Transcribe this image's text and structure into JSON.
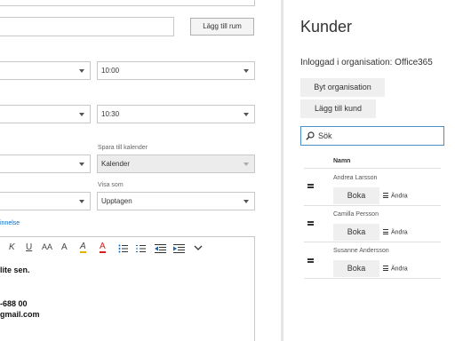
{
  "left_panel": {
    "add_room_button": "Lägg till rum",
    "start_time": "10:00",
    "end_time": "10:30",
    "save_to_calendar_label": "Spara till kalender",
    "calendar_value": "Kalender",
    "show_as_label": "Visa som",
    "show_as_value": "Upptagen",
    "reminder_link": "innelse",
    "toolbar": {
      "italic": "K",
      "underline": "U",
      "font_size_down": "AA",
      "font_size_up": "A",
      "highlight": "A",
      "font_color": "A"
    },
    "body_lines": [
      "lite sen.",
      "-688 00",
      "gmail.com"
    ]
  },
  "right_panel": {
    "title": "Kunder",
    "logged_in_text": "Inloggad i organisation: Office365",
    "switch_org_button": "Byt organisation",
    "add_customer_button": "Lägg till kund",
    "search_placeholder": "Sök",
    "column_header": "Namn",
    "customers": [
      {
        "name": "Andrea Larsson",
        "book_label": "Boka",
        "edit_label": "Ändra"
      },
      {
        "name": "Camilla Persson",
        "book_label": "Boka",
        "edit_label": "Ändra"
      },
      {
        "name": "Susanne Andersson",
        "book_label": "Boka",
        "edit_label": "Ändra"
      }
    ]
  },
  "colors": {
    "accent_blue": "#0a6ac0",
    "search_border": "#4a90c8",
    "font_color_red": "#d02020",
    "highlight_yellow": "#e0b000"
  },
  "icons": [
    "dropdown-caret-icon",
    "search-icon",
    "hamburger-menu-icon",
    "bullets-icon",
    "numbering-icon",
    "outdent-icon",
    "indent-icon",
    "chevron-down-icon"
  ]
}
